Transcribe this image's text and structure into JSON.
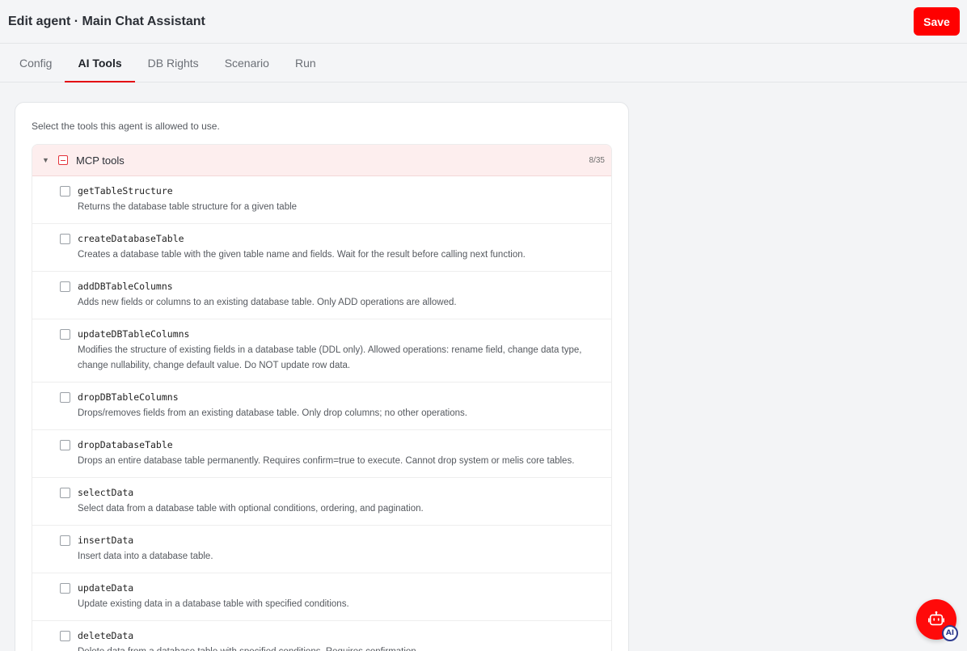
{
  "header": {
    "title": "Edit agent · Main Chat Assistant",
    "save_label": "Save"
  },
  "tabs": [
    {
      "label": "Config",
      "active": false
    },
    {
      "label": "AI Tools",
      "active": true
    },
    {
      "label": "DB Rights",
      "active": false
    },
    {
      "label": "Scenario",
      "active": false
    },
    {
      "label": "Run",
      "active": false
    }
  ],
  "main": {
    "intro": "Select the tools this agent is allowed to use.",
    "group": {
      "name": "MCP tools",
      "count": "8/35",
      "expanded_icon": "caret-down-icon",
      "tools": [
        {
          "name": "getTableStructure",
          "desc": "Returns the database table structure for a given table"
        },
        {
          "name": "createDatabaseTable",
          "desc": "Creates a database table with the given table name and fields. Wait for the result before calling next function."
        },
        {
          "name": "addDBTableColumns",
          "desc": "Adds new fields or columns to an existing database table. Only ADD operations are allowed."
        },
        {
          "name": "updateDBTableColumns",
          "desc": "Modifies the structure of existing fields in a database table (DDL only). Allowed operations: rename field, change data type, change nullability, change default value. Do NOT update row data."
        },
        {
          "name": "dropDBTableColumns",
          "desc": "Drops/removes fields from an existing database table. Only drop columns; no other operations."
        },
        {
          "name": "dropDatabaseTable",
          "desc": "Drops an entire database table permanently. Requires confirm=true to execute. Cannot drop system or melis core tables."
        },
        {
          "name": "selectData",
          "desc": "Select data from a database table with optional conditions, ordering, and pagination."
        },
        {
          "name": "insertData",
          "desc": "Insert data into a database table."
        },
        {
          "name": "updateData",
          "desc": "Update existing data in a database table with specified conditions."
        },
        {
          "name": "deleteData",
          "desc": "Delete data from a database table with specified conditions. Requires confirmation."
        }
      ]
    }
  },
  "assistant_fab": {
    "icon": "robot-icon",
    "badge": "AI"
  },
  "colors": {
    "accent": "#ff0000",
    "group_header_bg": "#fdeeee"
  }
}
